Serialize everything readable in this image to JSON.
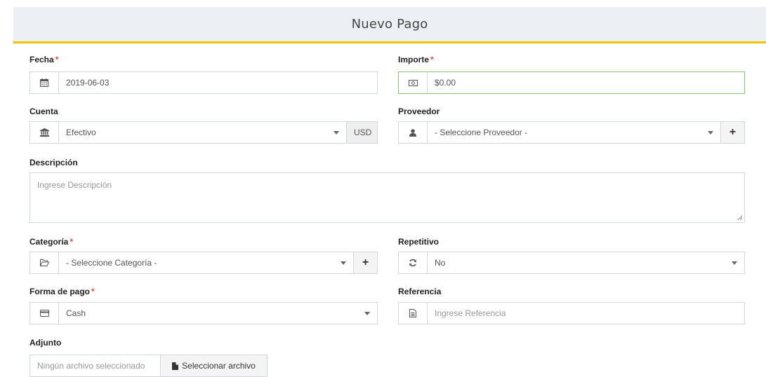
{
  "panel": {
    "title": "Nuevo Pago"
  },
  "fields": {
    "fecha": {
      "label": "Fecha",
      "required": "*",
      "value": "2019-06-03",
      "icon": "calendar-icon"
    },
    "importe": {
      "label": "Importe",
      "required": "*",
      "value": "$0.00",
      "icon": "money-icon",
      "border_color": "#8cc276"
    },
    "cuenta": {
      "label": "Cuenta",
      "value": "Efectivo",
      "currency": "USD",
      "icon": "bank-icon"
    },
    "proveedor": {
      "label": "Proveedor",
      "value": "- Seleccione Proveedor -",
      "icon": "user-icon",
      "add": "+"
    },
    "descripcion": {
      "label": "Descripción",
      "placeholder": "Ingrese Descripción"
    },
    "categoria": {
      "label": "Categoría",
      "required": "*",
      "value": "- Seleccione Categoría -",
      "icon": "folder-open-icon",
      "add": "+"
    },
    "repetitivo": {
      "label": "Repetitivo",
      "value": "No",
      "icon": "refresh-icon"
    },
    "forma_pago": {
      "label": "Forma de pago",
      "required": "*",
      "value": "Cash",
      "icon": "credit-card-icon"
    },
    "referencia": {
      "label": "Referencia",
      "placeholder": "Ingrese Referencia",
      "icon": "file-text-icon"
    },
    "adjunto": {
      "label": "Adjunto",
      "file_name": "Ningún archivo seleccionado",
      "button": "Seleccionar archivo",
      "icon": "file-icon"
    }
  },
  "colors": {
    "accent": "#f3c300",
    "required": "#dd4b39",
    "header_bg": "#ecf0f5"
  }
}
